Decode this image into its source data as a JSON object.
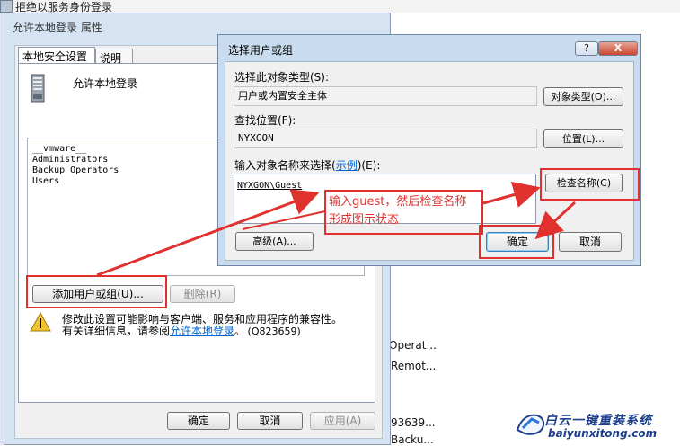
{
  "background": {
    "title": "拒绝以服务身份登录",
    "list": [
      "Operat...",
      "Remot...",
      "93639...",
      "Backu..."
    ]
  },
  "properties": {
    "title": "允许本地登录 属性",
    "tabs": [
      "本地安全设置",
      "说明"
    ],
    "policy_name": "允许本地登录",
    "members": [
      "__vmware__",
      "Administrators",
      "Backup Operators",
      "Users"
    ],
    "add_button": "添加用户或组(U)...",
    "remove_button": "删除(R)",
    "warning_line1": "修改此设置可能影响与客户端、服务和应用程序的兼容性。",
    "warning_line2_prefix": "有关详细信息，请参阅",
    "warning_link": "允许本地登录",
    "warning_line2_suffix": "。 (Q823659)",
    "ok": "确定",
    "cancel": "取消",
    "apply": "应用(A)"
  },
  "select_dialog": {
    "title": "选择用户或组",
    "help_icon": "?",
    "close_icon": "X",
    "object_type_label": "选择此对象类型(S):",
    "object_type_value": "用户或内置安全主体",
    "object_type_button": "对象类型(O)...",
    "location_label": "查找位置(F):",
    "location_value": "NYXGON",
    "location_button": "位置(L)...",
    "names_label_prefix": "输入对象名称来选择(",
    "names_label_link": "示例",
    "names_label_suffix": ")(E):",
    "names_value": "NYXGON\\Guest",
    "check_button": "检查名称(C)",
    "advanced_button": "高级(A)...",
    "ok": "确定",
    "cancel": "取消"
  },
  "annotation": {
    "line1": "输入guest，然后检查名称",
    "line2": "形成图示状态",
    "color": "#e0312f"
  },
  "watermark": {
    "line1": "白云一键重装系统",
    "line2": "baiyunxitong.com"
  }
}
